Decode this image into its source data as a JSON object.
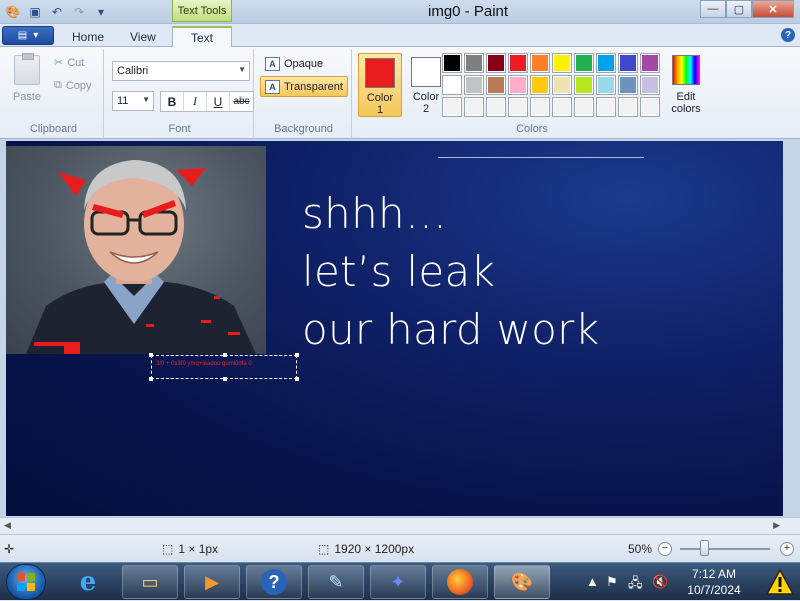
{
  "titlebar": {
    "title": "img0 - Paint",
    "context_tab": "Text Tools",
    "minimize": "—",
    "maximize": "▢",
    "close": "✕"
  },
  "tabs": {
    "home": "Home",
    "view": "View",
    "text": "Text",
    "help": "?"
  },
  "clipboard": {
    "label": "Clipboard",
    "paste": "Paste",
    "cut": "Cut",
    "copy": "Copy"
  },
  "font": {
    "label": "Font",
    "family": "Calibri",
    "size": "11",
    "bold": "B",
    "italic": "I",
    "underline": "U",
    "strikethrough": "abc"
  },
  "background": {
    "label": "Background",
    "opaque": "Opaque",
    "transparent": "Transparent"
  },
  "colors": {
    "label": "Colors",
    "color1_label_line1": "Color",
    "color1_label_line2": "1",
    "color2_label_line1": "Color",
    "color2_label_line2": "2",
    "color1": "#e81c1c",
    "color2": "#ffffff",
    "edit_line1": "Edit",
    "edit_line2": "colors",
    "palette": [
      "#000000",
      "#7f7f7f",
      "#880015",
      "#ed1c24",
      "#ff7f27",
      "#fff200",
      "#22b14c",
      "#00a2e8",
      "#3f48cc",
      "#a349a4",
      "#ffffff",
      "#c3c3c3",
      "#b97a57",
      "#ffaec9",
      "#ffc90e",
      "#efe4b0",
      "#b5e61d",
      "#99d9ea",
      "#7092be",
      "#c8bfe7",
      "#f2f2f2",
      "#f2f2f2",
      "#f2f2f2",
      "#f2f2f2",
      "#f2f2f2",
      "#f2f2f2",
      "#f2f2f2",
      "#f2f2f2",
      "#f2f2f2",
      "#f2f2f2"
    ]
  },
  "canvas": {
    "headline_line1": "shhh…",
    "headline_line2": "let’s leak",
    "headline_line3": "our hard work",
    "textbox_text": "3/0 + 0x3f0 ymq+leadoo gumi0ofa 0"
  },
  "statusbar": {
    "selection_size": "1 × 1px",
    "image_size": "1920 × 1200px",
    "zoom": "50%"
  },
  "taskbar": {
    "time": "7:12 AM",
    "date": "10/7/2024"
  }
}
